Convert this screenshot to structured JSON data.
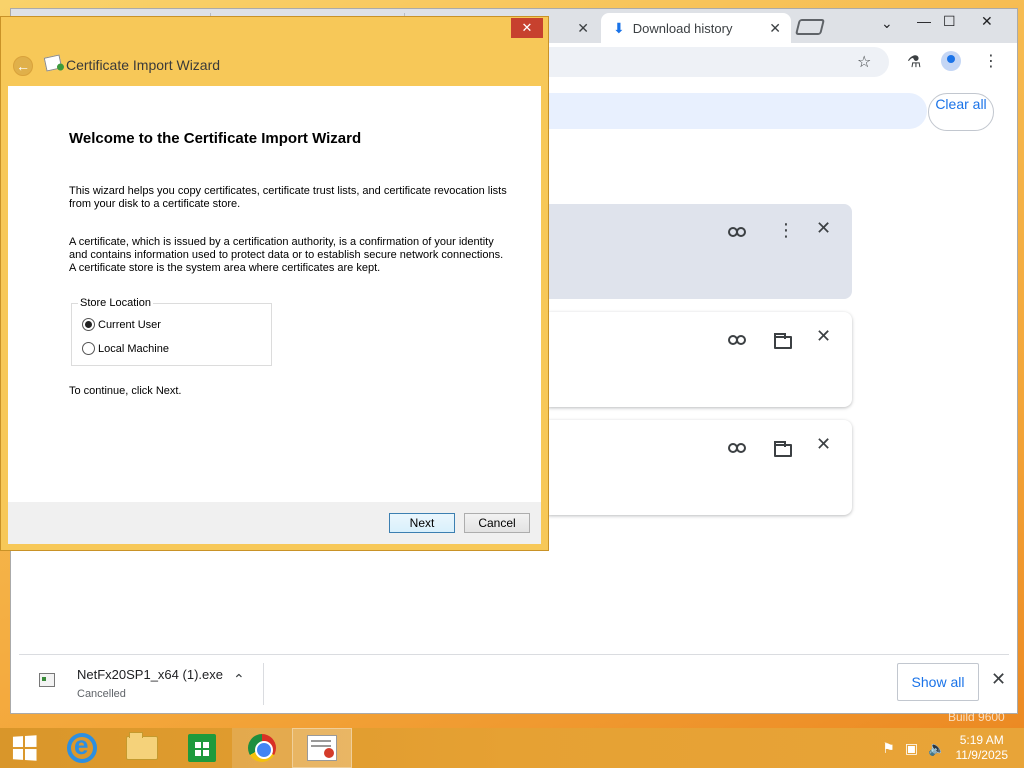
{
  "browser": {
    "tabs": [
      {
        "label": "",
        "active": false
      },
      {
        "label": "",
        "active": false
      },
      {
        "label": "Download history",
        "active": true
      }
    ],
    "tab_close_glyph": "✕",
    "window_controls": {
      "dropdown": "⌄",
      "minimize": "—",
      "maximize": "☐",
      "close": "✕"
    },
    "download_history": {
      "clear_all_label": "Clear all",
      "card_actions": {
        "link": "link-icon",
        "more": "⋮",
        "folder": "folder-icon",
        "remove": "✕"
      }
    },
    "download_shelf": {
      "file_name": "NetFx20SP1_x64 (1).exe",
      "status": "Cancelled",
      "chevron": "⌃",
      "show_all_label": "Show all",
      "close_glyph": "✕"
    }
  },
  "wizard": {
    "window_title": "Certificate Import Wizard",
    "close_glyph": "✕",
    "back_glyph": "←",
    "heading": "Welcome to the Certificate Import Wizard",
    "paragraph_1": "This wizard helps you copy certificates, certificate trust lists, and certificate revocation lists from your disk to a certificate store.",
    "paragraph_2": "A certificate, which is issued by a certification authority, is a confirmation of your identity and contains information used to protect data or to establish secure network connections. A certificate store is the system area where certificates are kept.",
    "store_location": {
      "legend": "Store Location",
      "options": [
        {
          "label": "Current User",
          "checked": true
        },
        {
          "label": "Local Machine",
          "checked": false
        }
      ]
    },
    "continue_text": "To continue, click Next.",
    "next_label": "Next",
    "cancel_label": "Cancel"
  },
  "taskbar": {
    "clock_time": "5:19 AM",
    "clock_date": "11/9/2025",
    "watermark": "Build 9600"
  },
  "colors": {
    "accent": "#1a73e8",
    "wizard_frame": "#f7c858",
    "close_red": "#c7412e"
  }
}
